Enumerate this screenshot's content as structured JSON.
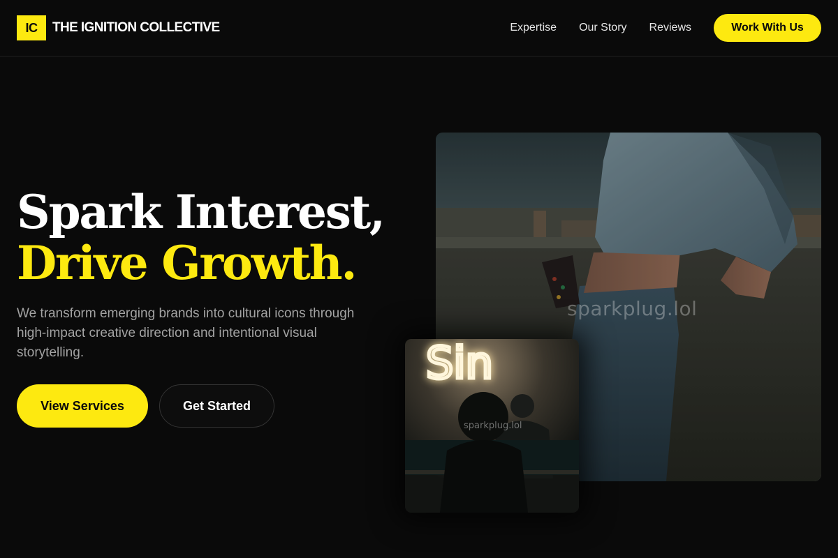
{
  "header": {
    "logo_text": "IC",
    "brand_name": "THE IGNITION COLLECTIVE",
    "nav": [
      "Expertise",
      "Our Story",
      "Reviews"
    ],
    "cta_label": "Work With Us"
  },
  "hero": {
    "title_line1": "Spark Interest,",
    "title_line2": "Drive Growth.",
    "subtitle": "We transform emerging brands into cultural icons through high-impact creative direction and intentional visual storytelling.",
    "primary_button": "View Services",
    "secondary_button": "Get Started"
  },
  "media": {
    "main_watermark": "sparkplug.lol",
    "small_watermark": "sparkplug.lol",
    "neon_text": "Sin"
  },
  "colors": {
    "accent": "#fde910",
    "background": "#0a0a0a",
    "muted_text": "#a3a3a3"
  }
}
